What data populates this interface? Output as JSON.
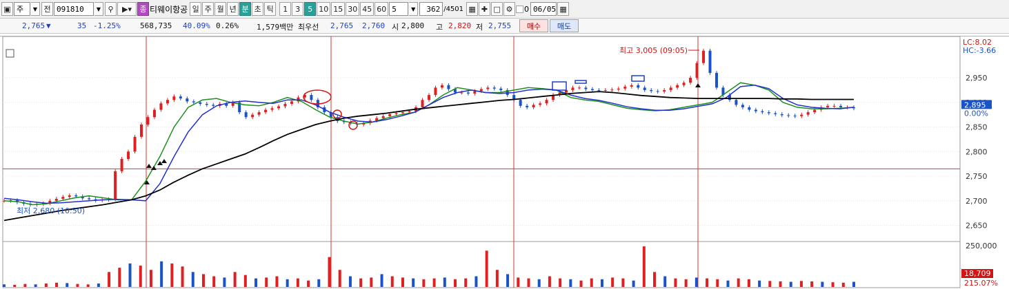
{
  "toolbar": {
    "market_label": "주",
    "code_prefix": "전",
    "stock_code": "091810",
    "badge": "종",
    "stock_name": "티웨이항공",
    "period_tabs": [
      "일",
      "주",
      "월",
      "년",
      "분",
      "초",
      "틱"
    ],
    "active_period": "분",
    "interval_tabs": [
      "1",
      "3",
      "5",
      "10",
      "15",
      "30",
      "45",
      "60"
    ],
    "active_interval": "5",
    "interval_value": "5",
    "count_value": "362",
    "count_total": "/4501",
    "checkbox_label": "0",
    "date_value": "06/05",
    "icons": [
      "window-icon",
      "dropdown-icon",
      "search-icon",
      "speaker-icon",
      "candle-icon",
      "crosshair-icon",
      "save-icon",
      "gear-icon",
      "calendar-icon"
    ]
  },
  "quote": {
    "price": "2,765",
    "direction": "▼",
    "change": "35",
    "change_pct": "-1.25%",
    "volume": "568,735",
    "volume_ratio": "40.09%",
    "turnover": "0.26%",
    "amount": "1,579백만",
    "best_label": "최우선",
    "ask": "2,765",
    "bid": "2,760",
    "open_label": "시",
    "open": "2,800",
    "high_label": "고",
    "high": "2,820",
    "low_label": "저",
    "low": "2,755",
    "buy_label": "매수",
    "sell_label": "매도"
  },
  "chart_data": {
    "type": "line",
    "title": "",
    "xlabel": "",
    "ylabel": "",
    "ylim": [
      2620,
      3020
    ],
    "yticks": [
      2650,
      2700,
      2750,
      2800,
      2850,
      2900,
      2950
    ],
    "ytick_labels": [
      "2,650",
      "2,700",
      "2,750",
      "2,800",
      "2,850",
      "2,900",
      "2,950"
    ],
    "current_price": 2765,
    "current_price_label": "2,895",
    "current_price_pct": "0.00%",
    "lc_label": "LC:8.02",
    "hc_label": "HC:-3.66",
    "high_annotation": "최고 3,005 (09:05)",
    "low_annotation": "최저 2,680 (10:50)",
    "volume_max_label": "250,000",
    "volume_current_label": "18,709",
    "volume_pct_label": "215.07%",
    "colors": {
      "up": "#e02020",
      "down": "#1a52c8",
      "ma5": "#1a8f1a",
      "ma20": "#1f2fd0",
      "ma60": "#000000",
      "day_line": "#e03030"
    },
    "series": [
      {
        "values": [
          2700,
          2698,
          2692,
          2694,
          2700,
          2706,
          2710,
          2706,
          2702,
          2702,
          2740,
          2790,
          2850,
          2890,
          2905,
          2908,
          2900,
          2895,
          2893,
          2900,
          2910,
          2902,
          2885,
          2870,
          2862,
          2856,
          2860,
          2868,
          2875,
          2880,
          2895,
          2915,
          2930,
          2925,
          2920,
          2920,
          2925,
          2930,
          2928,
          2925,
          2910,
          2905,
          2902,
          2895,
          2888,
          2885,
          2883,
          2885,
          2890,
          2895,
          2900,
          2920,
          2940,
          2935,
          2925,
          2900,
          2890,
          2887,
          2887,
          2888,
          2890
        ]
      },
      {
        "values": [
          2705,
          2702,
          2698,
          2695,
          2696,
          2698,
          2700,
          2702,
          2703,
          2702,
          2700,
          2735,
          2790,
          2840,
          2875,
          2893,
          2900,
          2903,
          2900,
          2898,
          2905,
          2905,
          2895,
          2880,
          2870,
          2862,
          2860,
          2865,
          2872,
          2880,
          2895,
          2910,
          2920,
          2925,
          2920,
          2918,
          2920,
          2925,
          2927,
          2925,
          2915,
          2908,
          2904,
          2898,
          2891,
          2887,
          2884,
          2884,
          2887,
          2892,
          2897,
          2910,
          2932,
          2935,
          2928,
          2908,
          2895,
          2890,
          2888,
          2887,
          2890
        ]
      },
      {
        "values": [
          2660,
          2665,
          2670,
          2675,
          2680,
          2684,
          2688,
          2692,
          2697,
          2702,
          2710,
          2722,
          2738,
          2752,
          2765,
          2775,
          2785,
          2795,
          2808,
          2822,
          2835,
          2845,
          2855,
          2862,
          2868,
          2872,
          2875,
          2878,
          2882,
          2886,
          2889,
          2892,
          2895,
          2898,
          2901,
          2904,
          2906,
          2909,
          2912,
          2915,
          2918,
          2920,
          2922,
          2920,
          2917,
          2914,
          2912,
          2910,
          2909,
          2908,
          2908,
          2908,
          2908,
          2908,
          2908,
          2907,
          2907,
          2906,
          2906,
          2906,
          2906
        ]
      }
    ],
    "candles": [
      2700,
      2701,
      2697,
      2694,
      2692,
      2693,
      2695,
      2700,
      2704,
      2708,
      2711,
      2709,
      2705,
      2703,
      2701,
      2702,
      2703,
      2760,
      2785,
      2800,
      2830,
      2855,
      2870,
      2885,
      2898,
      2905,
      2912,
      2908,
      2902,
      2900,
      2897,
      2895,
      2893,
      2897,
      2893,
      2900,
      2880,
      2870,
      2875,
      2880,
      2885,
      2888,
      2892,
      2897,
      2902,
      2910,
      2915,
      2905,
      2890,
      2880,
      2870,
      2862,
      2860,
      2857,
      2855,
      2858,
      2863,
      2868,
      2872,
      2876,
      2878,
      2880,
      2882,
      2890,
      2905,
      2915,
      2930,
      2935,
      2927,
      2920,
      2920,
      2918,
      2923,
      2927,
      2930,
      2928,
      2925,
      2915,
      2905,
      2893,
      2890,
      2895,
      2898,
      2905,
      2915,
      2920,
      2925,
      2930,
      2930,
      2927,
      2925,
      2924,
      2925,
      2926,
      2928,
      2932,
      2935,
      2930,
      2925,
      2923,
      2922,
      2925,
      2930,
      2935,
      2940,
      2950,
      2980,
      3005,
      2960,
      2930,
      2915,
      2905,
      2895,
      2890,
      2885,
      2882,
      2880,
      2878,
      2876,
      2874,
      2873,
      2872,
      2875,
      2880,
      2885,
      2890,
      2893,
      2893,
      2890,
      2890,
      2888
    ],
    "volumes": [
      0.06,
      0.05,
      0.07,
      0.06,
      0.08,
      0.1,
      0.09,
      0.07,
      0.06,
      0.08,
      0.35,
      0.45,
      0.55,
      0.5,
      0.4,
      0.6,
      0.55,
      0.48,
      0.35,
      0.3,
      0.25,
      0.22,
      0.35,
      0.28,
      0.2,
      0.22,
      0.25,
      0.18,
      0.2,
      0.15,
      0.18,
      0.7,
      0.4,
      0.25,
      0.2,
      0.22,
      0.3,
      0.25,
      0.22,
      0.2,
      0.18,
      0.2,
      0.22,
      0.18,
      0.2,
      0.25,
      0.85,
      0.4,
      0.3,
      0.22,
      0.2,
      0.18,
      0.25,
      0.2,
      0.18,
      0.15,
      0.2,
      0.18,
      0.22,
      0.2,
      0.15,
      0.95,
      0.35,
      0.25,
      0.2,
      0.18,
      0.22,
      0.2,
      0.18,
      0.15,
      0.2,
      0.18,
      0.15,
      0.14,
      0.13,
      0.12,
      0.14,
      0.13,
      0.12,
      0.11,
      0.1,
      0.12
    ]
  }
}
